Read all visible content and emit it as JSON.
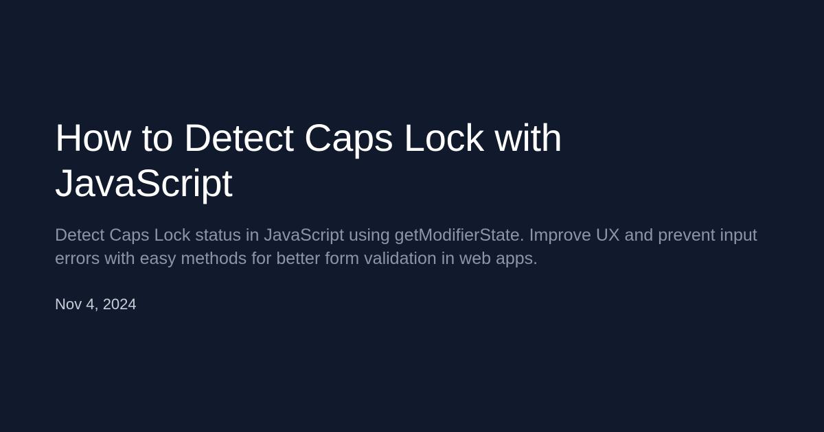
{
  "article": {
    "title": "How to Detect Caps Lock with JavaScript",
    "description": "Detect Caps Lock status in JavaScript using getModifierState. Improve UX and prevent input errors with easy methods for better form validation in web apps.",
    "date": "Nov 4, 2024"
  },
  "colors": {
    "background": "#111a2c",
    "title": "#ffffff",
    "description": "#8a95a8",
    "date": "#c8ced8"
  }
}
